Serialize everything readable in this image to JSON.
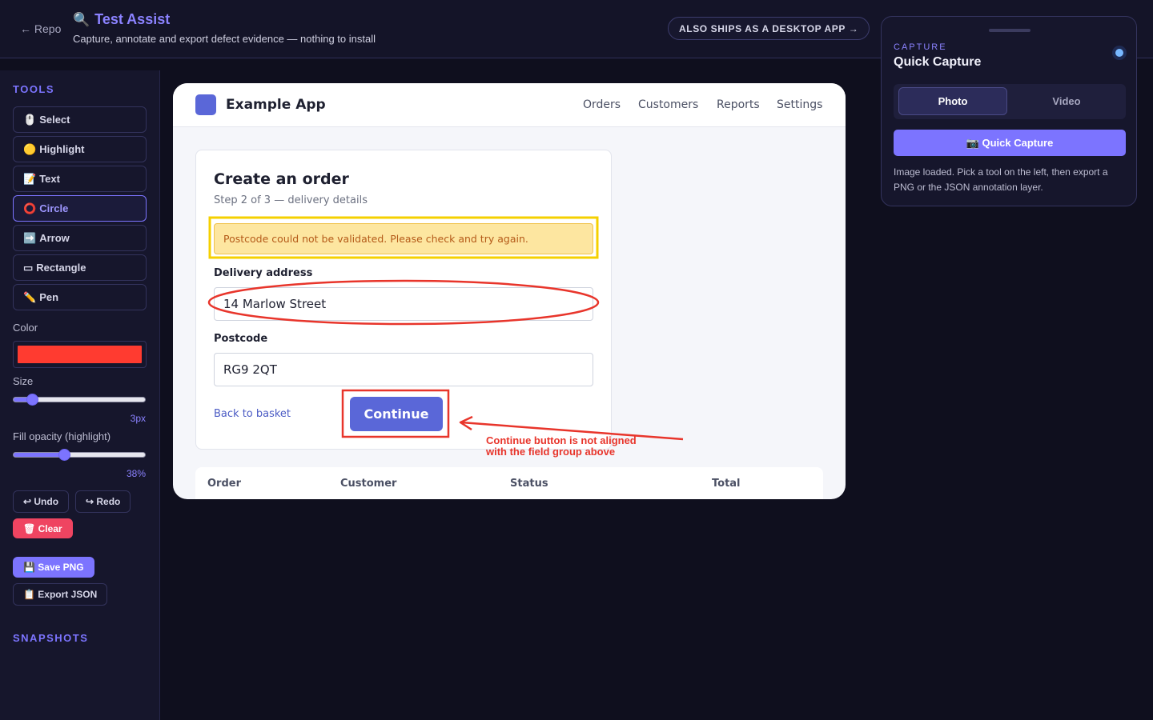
{
  "header": {
    "back_label": "← Repo",
    "title_icon": "🔍",
    "title": "Test Assist",
    "subtitle": "Capture, annotate and export defect evidence — nothing to install",
    "ships_badge": "ALSO SHIPS AS A DESKTOP APP →"
  },
  "sidebar": {
    "tools_heading": "TOOLS",
    "tools": [
      {
        "icon": "🖱️",
        "label": "Select"
      },
      {
        "icon": "🟡",
        "label": "Highlight"
      },
      {
        "icon": "📝",
        "label": "Text"
      },
      {
        "icon": "⭕",
        "label": "Circle"
      },
      {
        "icon": "➡️",
        "label": "Arrow"
      },
      {
        "icon": "▭",
        "label": "Rectangle"
      },
      {
        "icon": "✏️",
        "label": "Pen"
      }
    ],
    "active_tool": "Circle",
    "color_label": "Color",
    "color_value": "#ff3b30",
    "size_label": "Size",
    "size_value": "3px",
    "size_fraction": 0.14,
    "opacity_label": "Fill opacity (highlight)",
    "opacity_value": "38%",
    "opacity_fraction": 0.38,
    "undo_label": "↩ Undo",
    "redo_label": "↪ Redo",
    "clear_label": "🗑 Clear",
    "save_png_label": "💾 Save PNG",
    "export_json_label": "📋 Export JSON",
    "snapshots_heading": "SNAPSHOTS"
  },
  "example_app": {
    "name": "Example App",
    "nav": [
      "Orders",
      "Customers",
      "Reports",
      "Settings"
    ],
    "form": {
      "title": "Create an order",
      "step": "Step 2 of 3 — delivery details",
      "alert": "Postcode could not be validated. Please check and try again.",
      "address_label": "Delivery address",
      "address_value": "14 Marlow Street",
      "postcode_label": "Postcode",
      "postcode_value": "RG9 2QT",
      "back_link": "Back to basket",
      "continue_label": "Continue"
    },
    "table_headers": [
      "Order",
      "Customer",
      "Status",
      "Total"
    ]
  },
  "annotation": {
    "note_line1": "Continue button is not aligned",
    "note_line2": "with the field group above",
    "color": "#e8352b",
    "highlight_color": "#f5d000"
  },
  "capture_panel": {
    "eyebrow": "CAPTURE",
    "title": "Quick Capture",
    "mode_photo": "Photo",
    "mode_video": "Video",
    "active_mode": "Photo",
    "capture_button": "📷 Quick Capture",
    "message": "Image loaded. Pick a tool on the left, then export a PNG or the JSON annotation layer."
  }
}
